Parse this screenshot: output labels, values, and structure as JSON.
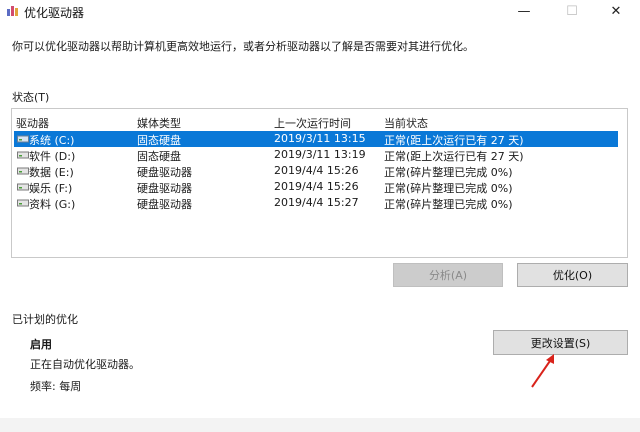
{
  "window": {
    "title": "优化驱动器",
    "minimize": "—",
    "maximize": "☐",
    "close": "✕"
  },
  "description": "你可以优化驱动器以帮助计算机更高效地运行，或者分析驱动器以了解是否需要对其进行优化。",
  "status_label": "状态(T)",
  "columns": [
    "驱动器",
    "媒体类型",
    "上一次运行时间",
    "当前状态"
  ],
  "drives": [
    {
      "name": "系统 (C:)",
      "media": "固态硬盘",
      "last_run": "2019/3/11 13:15",
      "status": "正常(距上次运行已有 27 天)",
      "selected": true
    },
    {
      "name": "软件 (D:)",
      "media": "固态硬盘",
      "last_run": "2019/3/11 13:19",
      "status": "正常(距上次运行已有 27 天)",
      "selected": false
    },
    {
      "name": "数据 (E:)",
      "media": "硬盘驱动器",
      "last_run": "2019/4/4 15:26",
      "status": "正常(碎片整理已完成 0%)",
      "selected": false
    },
    {
      "name": "娱乐 (F:)",
      "media": "硬盘驱动器",
      "last_run": "2019/4/4 15:26",
      "status": "正常(碎片整理已完成 0%)",
      "selected": false
    },
    {
      "name": "资料 (G:)",
      "media": "硬盘驱动器",
      "last_run": "2019/4/4 15:27",
      "status": "正常(碎片整理已完成 0%)",
      "selected": false
    }
  ],
  "buttons": {
    "analyze": "分析(A)",
    "optimize": "优化(O)",
    "change_settings": "更改设置(S)"
  },
  "scheduled": {
    "label": "已计划的优化",
    "state": "启用",
    "auto_text": "正在自动优化驱动器。",
    "frequency": "频率: 每周"
  },
  "colors": {
    "selection": "#0a78d7",
    "arrow": "#d9231b"
  }
}
